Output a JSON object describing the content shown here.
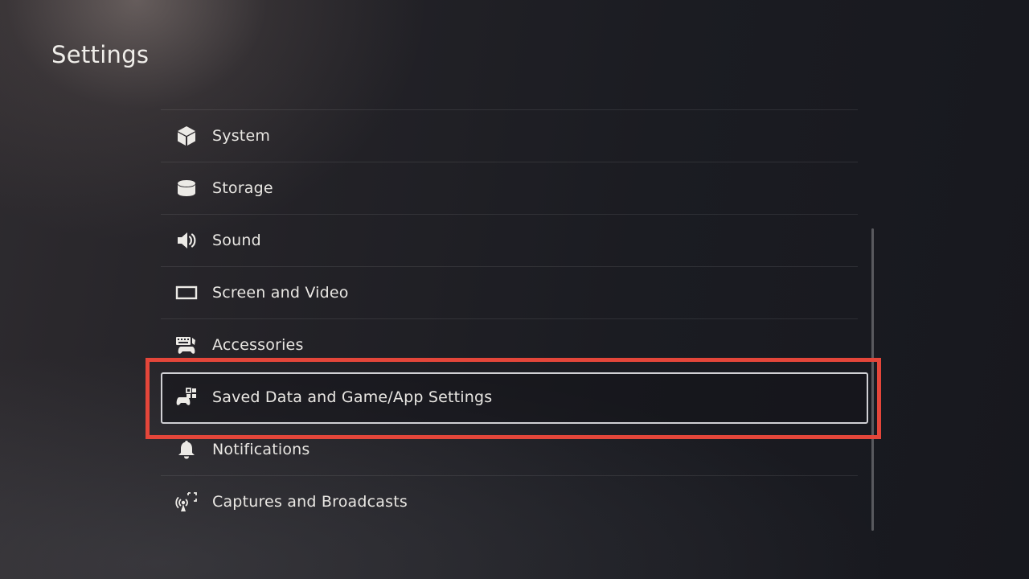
{
  "page": {
    "title": "Settings"
  },
  "menu": {
    "items": [
      {
        "label": "System",
        "icon": "system-cube-icon"
      },
      {
        "label": "Storage",
        "icon": "storage-drive-icon"
      },
      {
        "label": "Sound",
        "icon": "speaker-icon"
      },
      {
        "label": "Screen and Video",
        "icon": "screen-icon"
      },
      {
        "label": "Accessories",
        "icon": "accessories-icon"
      },
      {
        "label": "Saved Data and Game/App Settings",
        "icon": "saved-data-controller-icon",
        "selected": true
      },
      {
        "label": "Notifications",
        "icon": "bell-icon"
      },
      {
        "label": "Captures and Broadcasts",
        "icon": "broadcast-icon"
      }
    ]
  },
  "colors": {
    "highlight": "#e4463a",
    "focus_border": "#d0d0d4",
    "text": "#e9e7e3"
  }
}
